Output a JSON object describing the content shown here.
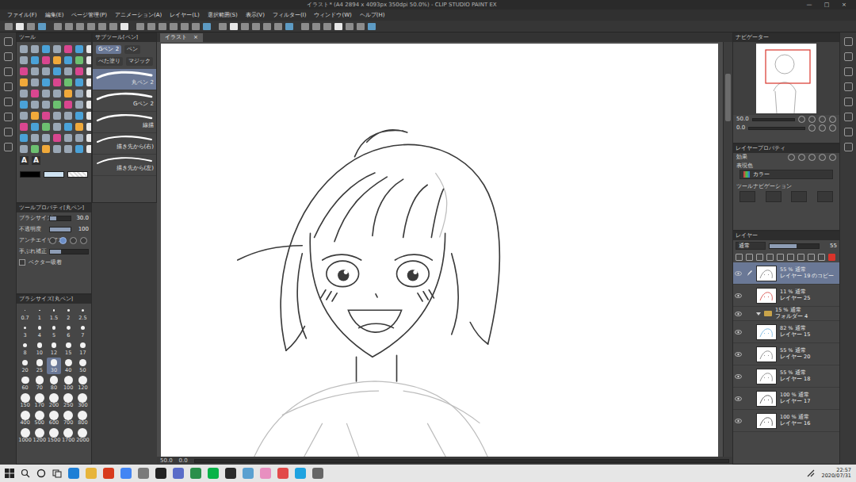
{
  "window": {
    "title": "イラスト* (A4 2894 x 4093px 350dpi 50.0%) - CLIP STUDIO PAINT EX",
    "controls": [
      "—",
      "□",
      "×"
    ]
  },
  "menu": [
    "ファイル(F)",
    "編集(E)",
    "ページ管理(P)",
    "アニメーション(A)",
    "レイヤー(L)",
    "選択範囲(S)",
    "表示(V)",
    "フィルター(I)",
    "ウィンドウ(W)",
    "ヘルプ(H)"
  ],
  "document_tab": {
    "label": "イラスト",
    "close": "×"
  },
  "tool_palette": {
    "title": "ツール",
    "glyphs": [
      "A",
      "A"
    ]
  },
  "subtool": {
    "title": "サブツール[ペン]",
    "groups": [
      {
        "label": "Gペン 2",
        "selected": true
      },
      {
        "label": "ペン",
        "selected": false
      },
      {
        "label": "べた塗り",
        "selected": false
      },
      {
        "label": "マジック",
        "selected": false
      }
    ],
    "items": [
      {
        "label": "丸ペン 2",
        "selected": true
      },
      {
        "label": "Gペン 2",
        "selected": false
      },
      {
        "label": "線描",
        "selected": false
      },
      {
        "label": "描き先から(右)",
        "selected": false
      },
      {
        "label": "描き先から(左)",
        "selected": false
      }
    ]
  },
  "tool_property": {
    "title": "ツールプロパティ[丸ペン]",
    "rows": [
      {
        "kind": "slider",
        "label": "ブラシサイズ",
        "value": "30.0",
        "level": 0.3
      },
      {
        "kind": "slider",
        "label": "不透明度",
        "value": "100",
        "level": 1.0
      },
      {
        "kind": "choice",
        "label": "アンチエイリアス",
        "options": [
          {
            "selected": false
          },
          {
            "selected": true
          },
          {
            "selected": false
          },
          {
            "selected": false
          }
        ]
      },
      {
        "kind": "meter",
        "label": "手ぶれ補正",
        "level": 0.3
      },
      {
        "kind": "check",
        "label": "ベクター吸着",
        "checked": false
      }
    ]
  },
  "brush_size": {
    "title": "ブラシサイズ[丸ペン]",
    "sizes": [
      {
        "label": "0.7",
        "selected": false
      },
      {
        "label": "1",
        "selected": false
      },
      {
        "label": "1.5",
        "selected": false
      },
      {
        "label": "2",
        "selected": false
      },
      {
        "label": "2.5",
        "selected": false
      },
      {
        "label": "3",
        "selected": false
      },
      {
        "label": "4",
        "selected": false
      },
      {
        "label": "5",
        "selected": false
      },
      {
        "label": "6",
        "selected": false
      },
      {
        "label": "7",
        "selected": false
      },
      {
        "label": "8",
        "selected": false
      },
      {
        "label": "10",
        "selected": false
      },
      {
        "label": "12",
        "selected": false
      },
      {
        "label": "15",
        "selected": false
      },
      {
        "label": "17",
        "selected": false
      },
      {
        "label": "20",
        "selected": false
      },
      {
        "label": "25",
        "selected": false
      },
      {
        "label": "30",
        "selected": true
      },
      {
        "label": "40",
        "selected": false
      },
      {
        "label": "50",
        "selected": false
      },
      {
        "label": "60",
        "selected": false
      },
      {
        "label": "70",
        "selected": false
      },
      {
        "label": "80",
        "selected": false
      },
      {
        "label": "100",
        "selected": false
      },
      {
        "label": "120",
        "selected": false
      },
      {
        "label": "150",
        "selected": false
      },
      {
        "label": "170",
        "selected": false
      },
      {
        "label": "200",
        "selected": false
      },
      {
        "label": "250",
        "selected": false
      },
      {
        "label": "300",
        "selected": false
      },
      {
        "label": "400",
        "selected": false
      },
      {
        "label": "500",
        "selected": false
      },
      {
        "label": "600",
        "selected": false
      },
      {
        "label": "700",
        "selected": false
      },
      {
        "label": "800",
        "selected": false
      },
      {
        "label": "1000",
        "selected": false
      },
      {
        "label": "1200",
        "selected": false
      },
      {
        "label": "1500",
        "selected": false
      },
      {
        "label": "1700",
        "selected": false
      },
      {
        "label": "2000",
        "selected": false
      }
    ]
  },
  "canvas_status": {
    "zoom": "50.0",
    "angle": "0.0"
  },
  "navigator": {
    "title": "ナビゲーター",
    "zoom": "50.0",
    "angle": "0.0"
  },
  "layer_property": {
    "title": "レイヤープロパティ",
    "effect": "効果",
    "color_label": "表現色",
    "color_value": "カラー",
    "tool_navigation": "ツールナビゲーション"
  },
  "layers": {
    "title": "レイヤー",
    "blend": "通常",
    "opacity": "55",
    "opacity_level": 0.55,
    "items": [
      {
        "kind": "layer",
        "mode": "55 % 通常",
        "name": "レイヤー 19 のコピー",
        "selected": true,
        "visible": true,
        "color": "#8a8a8a"
      },
      {
        "kind": "layer",
        "mode": "11 % 通常",
        "name": "レイヤー 25",
        "selected": false,
        "visible": true,
        "color": "#d9534f"
      },
      {
        "kind": "folder",
        "mode": "15 % 通常",
        "name": "フォルダー 4",
        "selected": false,
        "visible": true,
        "expanded": true,
        "color": "#c9a44a"
      },
      {
        "kind": "layer",
        "mode": "82 % 通常",
        "name": "レイヤー 15",
        "selected": false,
        "visible": true,
        "color": "#7ab8e0"
      },
      {
        "kind": "layer",
        "mode": "55 % 通常",
        "name": "レイヤー 20",
        "selected": false,
        "visible": true,
        "color": "#8a8a8a"
      },
      {
        "kind": "layer",
        "mode": "55 % 通常",
        "name": "レイヤー 18",
        "selected": false,
        "visible": true,
        "color": "#8a8a8a"
      },
      {
        "kind": "layer",
        "mode": "100 % 通常",
        "name": "レイヤー 17",
        "selected": false,
        "visible": true,
        "color": "#555555"
      },
      {
        "kind": "layer",
        "mode": "100 % 通常",
        "name": "レイヤー 16",
        "selected": false,
        "visible": true,
        "color": "#555555"
      }
    ]
  },
  "taskbar": {
    "time": "22:57",
    "date": "2020/07/31"
  }
}
